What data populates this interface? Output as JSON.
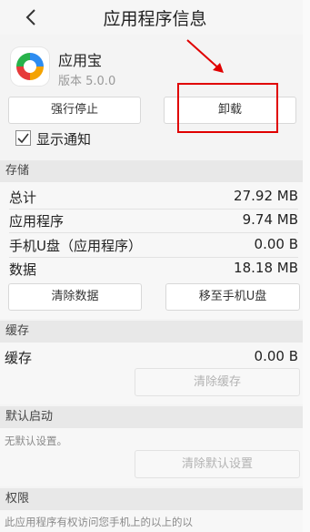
{
  "header": {
    "title": "应用程序信息",
    "back_icon": "chevron-left-icon"
  },
  "app": {
    "name": "应用宝",
    "version": "版本 5.0.0",
    "icon": "app-logo-icon"
  },
  "actions": {
    "force_stop": "强行停止",
    "uninstall": "卸载"
  },
  "notification": {
    "label": "显示通知",
    "checked": true
  },
  "storage": {
    "header": "存储",
    "rows": [
      {
        "label": "总计",
        "value": "27.92 MB"
      },
      {
        "label": "应用程序",
        "value": "9.74 MB"
      },
      {
        "label": "手机U盘（应用程序）",
        "value": "0.00 B"
      },
      {
        "label": "数据",
        "value": "18.18 MB"
      }
    ],
    "clear_data": "清除数据",
    "move_to_sd": "移至手机U盘"
  },
  "cache": {
    "header": "缓存",
    "label": "缓存",
    "value": "0.00 B",
    "clear_cache": "清除缓存"
  },
  "default_launch": {
    "header": "默认启动",
    "note": "无默认设置。",
    "clear_defaults": "清除默认设置"
  },
  "permissions": {
    "header": "权限",
    "note": "此应用程序有权访问您手机上的以上的以"
  },
  "annotation": {
    "color": "#e00000"
  }
}
